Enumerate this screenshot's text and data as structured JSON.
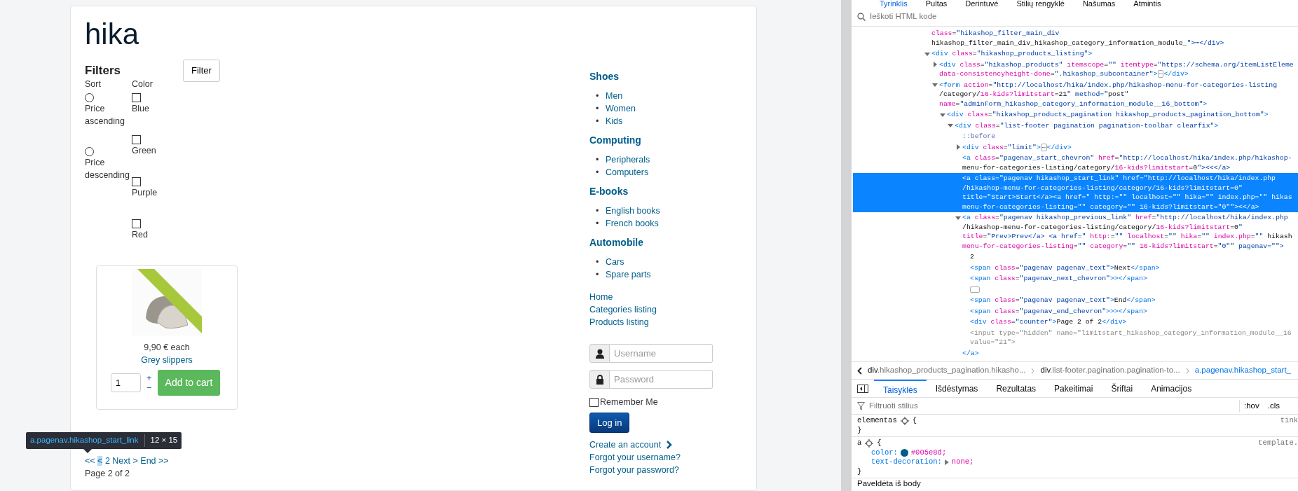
{
  "page": {
    "site_title": "hika",
    "filters": {
      "heading": "Filters",
      "button": "Filter",
      "sort": {
        "label": "Sort",
        "options": [
          {
            "label": "Price ascending",
            "selected": false
          },
          {
            "label": "Price descending",
            "selected": false
          }
        ]
      },
      "color": {
        "label": "Color",
        "options": [
          {
            "label": "Blue",
            "checked": false
          },
          {
            "label": "Green",
            "checked": false
          },
          {
            "label": "Purple",
            "checked": false
          },
          {
            "label": "Red",
            "checked": false
          }
        ]
      }
    },
    "products": [
      {
        "price": "9,90 € each",
        "name": "Grey slippers",
        "quantity": "1",
        "plus": "+",
        "minus": "−",
        "add_button": "Add to cart",
        "new_ribbon": true
      }
    ],
    "pagination": {
      "links": [
        {
          "text": "<<",
          "inspected": false
        },
        {
          "text": "<",
          "inspected": true
        },
        {
          "text": "2",
          "inspected": false
        },
        {
          "text": "Next",
          "inspected": false
        },
        {
          "text": ">",
          "inspected": false
        },
        {
          "text": "End",
          "inspected": false
        },
        {
          "text": ">>",
          "inspected": false
        }
      ],
      "counter": "Page 2 of 2"
    },
    "inspector_tooltip": {
      "selector": "a.pagenav.hikashop_start_link",
      "size": "12 × 15"
    },
    "categories": [
      {
        "name": "Shoes",
        "items": [
          {
            "marker": "•",
            "label": "Men"
          },
          {
            "marker": "•",
            "label": "Women"
          },
          {
            "marker": "•",
            "label": "Kids"
          }
        ]
      },
      {
        "name": "Computing",
        "items": [
          {
            "marker": "•",
            "label": "Peripherals"
          },
          {
            "marker": "•",
            "label": "Computers"
          }
        ]
      },
      {
        "name": "E-books",
        "items": [
          {
            "marker": "•",
            "label": "English books"
          },
          {
            "marker": "•",
            "label": "French books"
          }
        ]
      },
      {
        "name": "Automobile",
        "items": [
          {
            "marker": "•",
            "label": "Cars"
          },
          {
            "marker": "•",
            "label": "Spare parts"
          }
        ]
      }
    ],
    "menu": [
      "Home",
      "Categories listing",
      "Products listing"
    ],
    "login": {
      "username_placeholder": "Username",
      "password_placeholder": "Password",
      "remember": {
        "label": "Remember Me",
        "checked": false
      },
      "button": "Log in",
      "links": [
        {
          "text": "Create an account",
          "chevron": true
        },
        {
          "text": "Forgot your username?",
          "chevron": false
        },
        {
          "text": "Forgot your password?",
          "chevron": false
        }
      ]
    }
  },
  "devtools": {
    "tabs": [
      {
        "label": "Tyrinklis",
        "selected": true
      },
      {
        "label": "Pultas",
        "selected": false
      },
      {
        "label": "Derintuvė",
        "selected": false
      },
      {
        "label": "Stilių rengyklė",
        "selected": false
      },
      {
        "label": "Našumas",
        "selected": false
      },
      {
        "label": "Atmintis",
        "selected": false
      }
    ],
    "search": {
      "placeholder": "Ieškoti HTML kode"
    },
    "tree": [
      {
        "kind": "element",
        "selected": false,
        "lines": [
          "class=\"hikashop_filter_main_div",
          "hikashop_filter_main_div_hikashop_category_information_module_\">⋯</div>"
        ]
      },
      {
        "kind": "element",
        "expanded": true,
        "selected": false,
        "lines": [
          "<div class=\"hikashop_products_listing\">"
        ],
        "children": [
          {
            "kind": "element",
            "expanded": false,
            "selected": false,
            "lines": [
              "<div class=\"hikashop_products\" itemscope=\"\" itemtype=\"https://schema.org/itemListEleme",
              "data-consistencyheight-done=\".hikashop_subcontainer\">⋯</div>"
            ]
          },
          {
            "kind": "element",
            "expanded": true,
            "selected": false,
            "lines": [
              "<form action=\"http://localhost/hika/index.php/hikashop-menu-for-categories-listing",
              "/category/16-kids?limitstart=21\" method=\"post\"",
              "name=\"adminForm_hikashop_category_information_module__16_bottom\">"
            ],
            "children": [
              {
                "kind": "element",
                "expanded": true,
                "selected": false,
                "lines": [
                  "<div class=\"hikashop_products_pagination hikashop_products_pagination_bottom\">"
                ],
                "children": [
                  {
                    "kind": "element",
                    "expanded": true,
                    "selected": false,
                    "lines": [
                      "<div class=\"list-footer pagination pagination-toolbar clearfix\">"
                    ],
                    "children": [
                      {
                        "kind": "pseudo",
                        "selected": false,
                        "lines": [
                          "::before"
                        ]
                      },
                      {
                        "kind": "element",
                        "expanded": false,
                        "selected": false,
                        "lines": [
                          "<div class=\"limit\">⋯</div>"
                        ]
                      },
                      {
                        "kind": "element",
                        "selected": false,
                        "lines": [
                          "<a class=\"pagenav_start_chevron\" href=\"http://localhost/hika/index.php/hikashop-",
                          "menu-for-categories-listing/category/16-kids?limitstart=0\"><<</a>"
                        ]
                      },
                      {
                        "kind": "element",
                        "selected": true,
                        "lines": [
                          "<a class=\"pagenav hikashop_start_link\" href=\"http://localhost/hika/index.php",
                          "/hikashop-menu-for-categories-listing/category/16-kids?limitstart=0\"",
                          "title=\"Start>Start</a><a href=\" http:=\"\" localhost=\"\" hika=\"\" index.php=\"\" hikas",
                          "menu-for-categories-listing=\"\" category=\"\" 16-kids?limitstart=\"0\"\"><</a>"
                        ]
                      },
                      {
                        "kind": "element",
                        "expanded": true,
                        "selected": false,
                        "lines": [
                          "<a class=\"pagenav hikashop_previous_link\" href=\"http://localhost/hika/index.php",
                          "/hikashop-menu-for-categories-listing/category/16-kids?limitstart=0\"",
                          "title=\"Prev>Prev</a> <a href=\" http:=\"\" localhost=\"\" hika=\"\" index.php=\"\" hikash",
                          "menu-for-categories-listing=\"\" category=\"\" 16-kids?limitstart=\"0\"\" pagenav=\"\">"
                        ],
                        "children": [
                          {
                            "kind": "text",
                            "selected": false,
                            "lines": [
                              "2"
                            ]
                          },
                          {
                            "kind": "element",
                            "selected": false,
                            "lines": [
                              "<span class=\"pagenav pagenav_text\">Next</span>"
                            ]
                          },
                          {
                            "kind": "element",
                            "selected": false,
                            "lines": [
                              "<span class=\"pagenav_next_chevron\">></span>"
                            ]
                          },
                          {
                            "kind": "whitespace",
                            "selected": false
                          },
                          {
                            "kind": "element",
                            "selected": false,
                            "lines": [
                              "<span class=\"pagenav pagenav_text\">End</span>"
                            ]
                          },
                          {
                            "kind": "element",
                            "selected": false,
                            "lines": [
                              "<span class=\"pagenav_end_chevron\">>></span>"
                            ]
                          },
                          {
                            "kind": "element",
                            "selected": false,
                            "lines": [
                              "<div class=\"counter\">Page 2 of 2</div>"
                            ]
                          },
                          {
                            "kind": "hidden",
                            "selected": false,
                            "lines": [
                              "<input type=\"hidden\" name=\"limitstart_hikashop_category_information_module__16",
                              "value=\"21\">"
                            ]
                          }
                        ]
                      },
                      {
                        "kind": "element",
                        "selected": false,
                        "lines": [
                          "</a>"
                        ]
                      }
                    ]
                  }
                ]
              }
            ]
          }
        ]
      }
    ],
    "breadcrumb": [
      {
        "text": "div.hikashop_products_pagination.hikasho...",
        "selected": false
      },
      {
        "text": "div.list-footer.pagination.pagination-to...",
        "selected": false
      },
      {
        "text": "a.pagenav.hikashop_start_",
        "selected": true
      }
    ],
    "side_tabs": [
      {
        "label": "Taisyklės",
        "selected": true
      },
      {
        "label": "Išdėstymas",
        "selected": false
      },
      {
        "label": "Rezultatas",
        "selected": false
      },
      {
        "label": "Pakeitimai",
        "selected": false
      },
      {
        "label": "Šriftai",
        "selected": false
      },
      {
        "label": "Animacijos",
        "selected": false
      }
    ],
    "rules_filter": {
      "placeholder": "Filtruoti stilius",
      "buttons": [
        ":hov",
        ".cls"
      ]
    },
    "rules": [
      {
        "selector": "elementas",
        "open": "{",
        "close": "}",
        "source": "tink"
      },
      {
        "selector": "a",
        "open": "{",
        "close": "}",
        "source": "template.",
        "declarations": [
          {
            "property": "color:",
            "value": "#005e8d;",
            "swatch": true,
            "expandable": false
          },
          {
            "property": "text-decoration:",
            "value": "none;",
            "expandable": true
          }
        ]
      }
    ],
    "inherited_header": "Paveldėta iš body"
  }
}
